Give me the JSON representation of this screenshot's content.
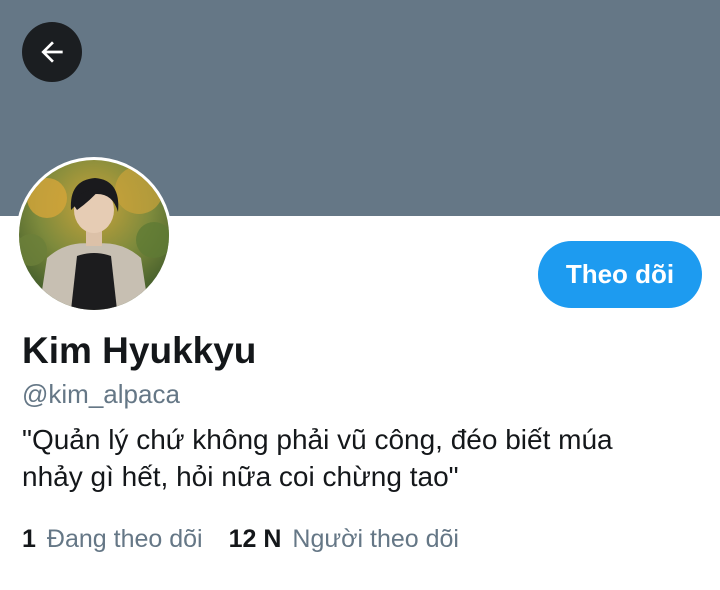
{
  "header": {
    "back_icon": "arrow-left-icon",
    "banner_color": "#657786"
  },
  "profile": {
    "avatar_icon": "profile-photo",
    "follow_label": "Theo dõi",
    "name": "Kim Hyukkyu",
    "handle": "@kim_alpaca",
    "bio_lines": [
      "\"Quản lý chứ không phải vũ công, đéo biết múa",
      "nhảy gì hết, hỏi nữa coi chừng tao\""
    ]
  },
  "stats": {
    "following_count": "1",
    "following_label": "Đang theo dõi",
    "followers_count": "12 N",
    "followers_label": "Người theo dõi"
  },
  "colors": {
    "accent": "#1d9bf0",
    "secondary_text": "#657786",
    "primary_text": "#14171a"
  }
}
